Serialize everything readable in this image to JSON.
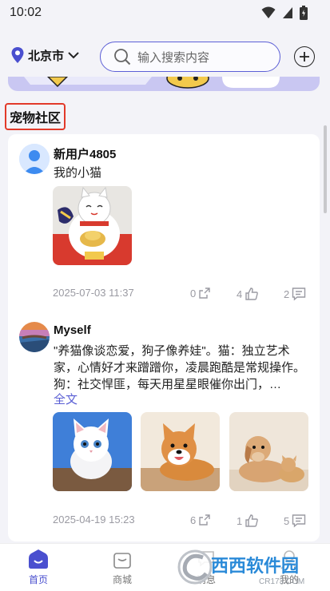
{
  "status_bar": {
    "time": "10:02"
  },
  "header": {
    "location": "北京市",
    "search_placeholder": "输入搜索内容"
  },
  "section": {
    "title": "宠物社区"
  },
  "posts": [
    {
      "username": "新用户4805",
      "text": "我的小猫",
      "date": "2025-07-03 11:37",
      "shares": "0",
      "likes": "4",
      "comments": "2"
    },
    {
      "username": "Myself",
      "text": "\"养猫像谈恋爱，狗子像养娃\"。猫：独立艺术家，心情好才来蹭蹭你，凌晨跑酷是常规操作。狗：社交悍匪，每天用星星眼催你出门，…",
      "more_label": "全文",
      "date": "2025-04-19 15:23",
      "shares": "6",
      "likes": "1",
      "comments": "5"
    }
  ],
  "tabs": [
    {
      "label": "首页",
      "active": true
    },
    {
      "label": "商城",
      "active": false
    },
    {
      "label": "消息",
      "active": false
    },
    {
      "label": "我的",
      "active": false
    }
  ],
  "watermark": {
    "text": "西西软件园",
    "url": "CR173.COM"
  },
  "colors": {
    "accent": "#5a5fd4",
    "highlight_border": "#e23a2a",
    "banner": "#c9c7f2"
  }
}
